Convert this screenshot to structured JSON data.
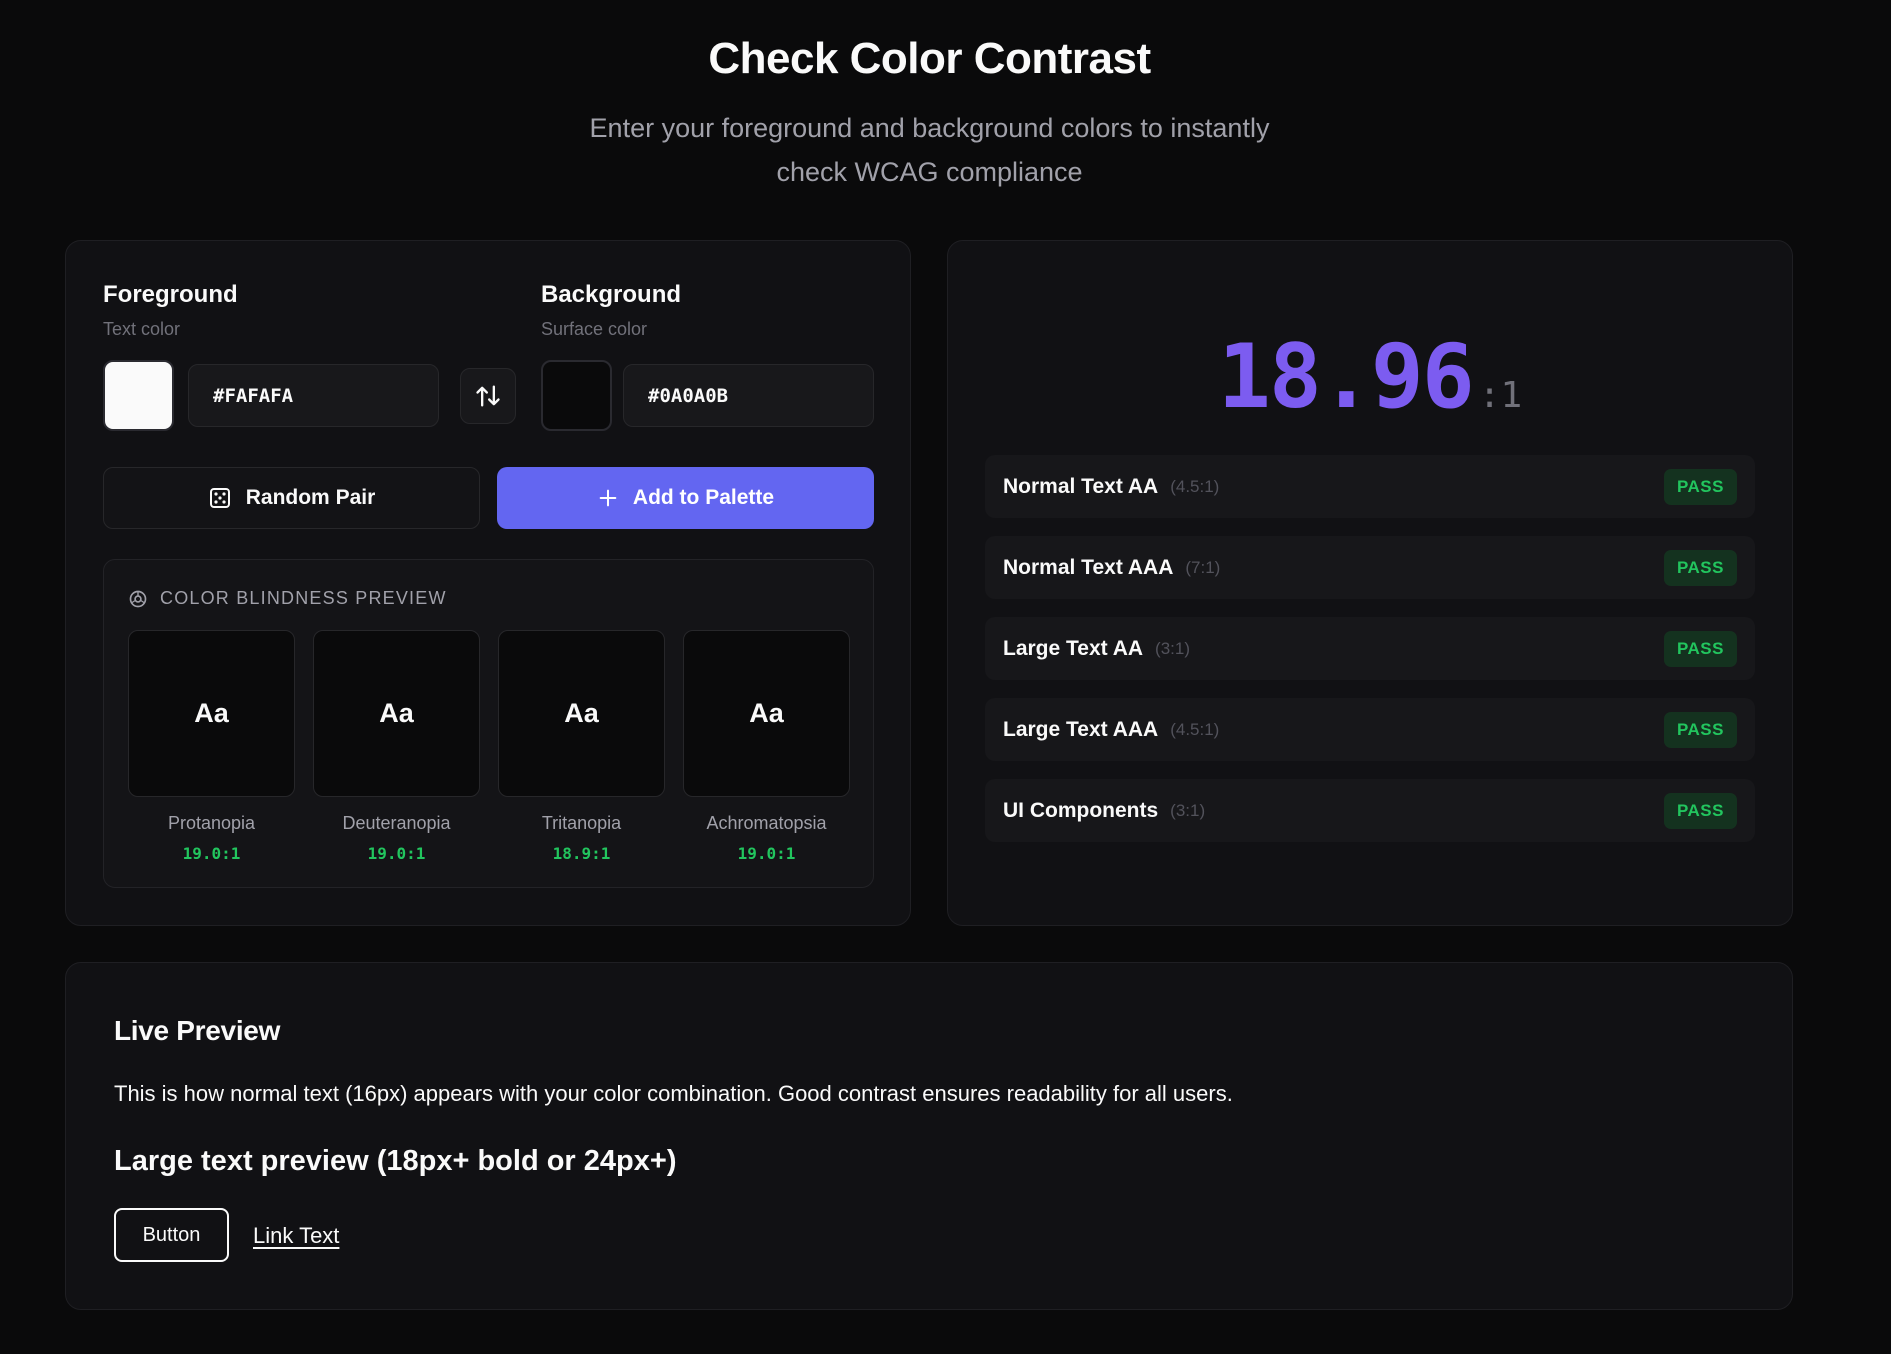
{
  "header": {
    "title": "Check Color Contrast",
    "subtitle": "Enter your foreground and background colors to instantly check WCAG compliance"
  },
  "foreground": {
    "label": "Foreground",
    "sublabel": "Text color",
    "value": "#FAFAFA",
    "swatch_color": "#fafafa"
  },
  "background": {
    "label": "Background",
    "sublabel": "Surface color",
    "value": "#0A0A0B",
    "swatch_color": "#0a0a0b"
  },
  "actions": {
    "swap_icon": "swap-vertical-icon",
    "random_label": "Random Pair",
    "random_icon": "dice-icon",
    "add_label": "Add to Palette",
    "add_icon": "plus-icon"
  },
  "color_blindness": {
    "title": "COLOR BLINDNESS PREVIEW",
    "icon": "eye-icon",
    "sample_text": "Aa",
    "items": [
      {
        "name": "Protanopia",
        "ratio": "19.0:1"
      },
      {
        "name": "Deuteranopia",
        "ratio": "19.0:1"
      },
      {
        "name": "Tritanopia",
        "ratio": "18.9:1"
      },
      {
        "name": "Achromatopsia",
        "ratio": "19.0:1"
      }
    ]
  },
  "result": {
    "ratio": "18.96",
    "suffix": ":1",
    "checks": [
      {
        "name": "Normal Text AA",
        "requirement": "(4.5:1)",
        "status": "PASS"
      },
      {
        "name": "Normal Text AAA",
        "requirement": "(7:1)",
        "status": "PASS"
      },
      {
        "name": "Large Text AA",
        "requirement": "(3:1)",
        "status": "PASS"
      },
      {
        "name": "Large Text AAA",
        "requirement": "(4.5:1)",
        "status": "PASS"
      },
      {
        "name": "UI Components",
        "requirement": "(3:1)",
        "status": "PASS"
      }
    ]
  },
  "live_preview": {
    "title": "Live Preview",
    "normal_text": "This is how normal text (16px) appears with your color combination. Good contrast ensures readability for all users.",
    "large_text": "Large text preview (18px+ bold or 24px+)",
    "button_label": "Button",
    "link_label": "Link Text"
  },
  "colors": {
    "accent": "#6366f1",
    "ratio": "#7c5cf0",
    "pass": "#22c55e"
  }
}
